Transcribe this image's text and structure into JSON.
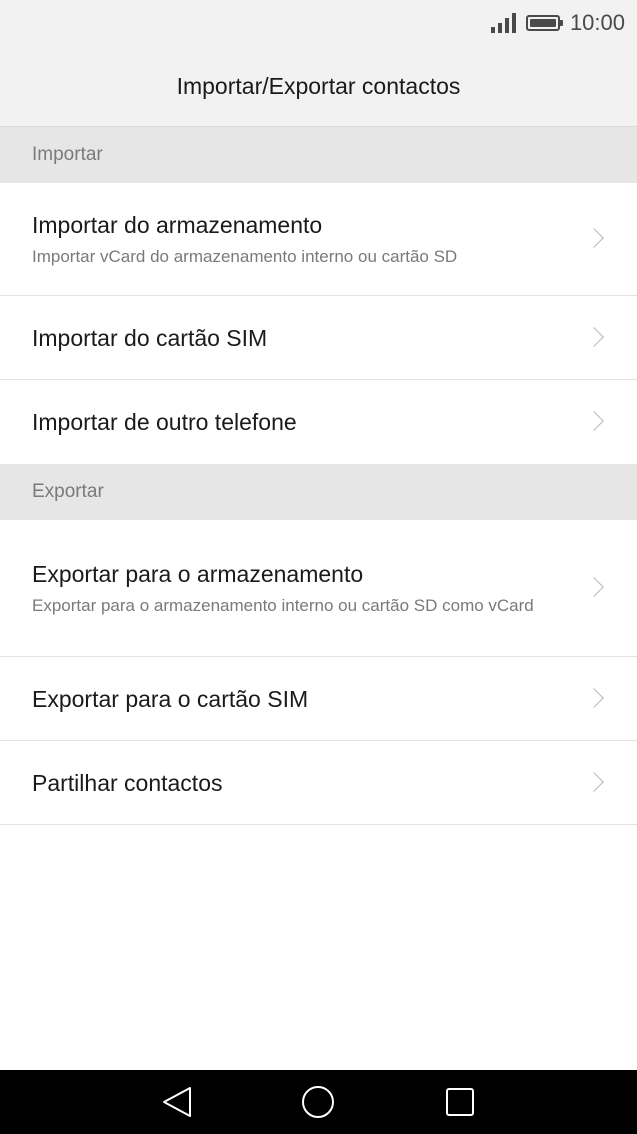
{
  "status_bar": {
    "time": "10:00",
    "icons": [
      "signal-icon",
      "battery-icon"
    ]
  },
  "header": {
    "title": "Importar/Exportar contactos"
  },
  "sections": [
    {
      "label": "Importar",
      "items": [
        {
          "title": "Importar do armazenamento",
          "subtitle": "Importar vCard do armazenamento interno ou cartão SD"
        },
        {
          "title": "Importar do cartão SIM"
        },
        {
          "title": "Importar de outro telefone"
        }
      ]
    },
    {
      "label": "Exportar",
      "items": [
        {
          "title": "Exportar para o armazenamento",
          "subtitle": "Exportar para o armazenamento interno ou cartão SD como vCard"
        },
        {
          "title": "Exportar para o cartão SIM"
        },
        {
          "title": "Partilhar contactos"
        }
      ]
    }
  ],
  "nav_bar": {
    "icons": [
      "back-icon",
      "home-icon",
      "recents-icon"
    ]
  },
  "colors": {
    "header_bg": "#f2f2f2",
    "section_bg": "#e6e6e6",
    "nav_bg": "#000000",
    "chevron": "#b5b5b5"
  }
}
